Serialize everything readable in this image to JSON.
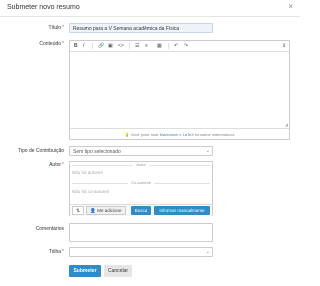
{
  "modal": {
    "title": "Submeter novo resumo",
    "close_glyph": "×"
  },
  "fields": {
    "title_label": "Título",
    "title_value": "Resumo para a V Semana acadêmica da Física",
    "content_label": "Conteúdo",
    "contribution_label": "Tipo de Contribuição",
    "contribution_value": "Sem tipo selecionado",
    "author_label": "Autor",
    "comments_label": "Comentários",
    "track_label": "Trilha",
    "required_mark": "*"
  },
  "editor": {
    "toolbar": {
      "bold": "B",
      "italic": "I",
      "link": "🔗",
      "comment": "▣",
      "code": "<>",
      "bullets": "☰",
      "numbered": "≡",
      "table": "▦",
      "undo": "↶",
      "redo": "↷",
      "info": "ℹ"
    },
    "hint_prefix": "Você pode usar",
    "hint_markdown": "Markdown",
    "hint_and": "e",
    "hint_latex": "LaTeX",
    "hint_suffix": "formatos matemáticos",
    "hint_icon": "💡"
  },
  "authors": {
    "author_section": "Autor",
    "author_empty": "Não há autores",
    "coauthor_section": "Co-autores",
    "coauthor_empty": "Não há co-autores",
    "sort_glyph": "⇅",
    "add_me_label": "Me adicione",
    "search_label": "Busca",
    "manual_label": "Informar manualmente",
    "user_icon": "👤"
  },
  "footer": {
    "submit_label": "Submeter",
    "cancel_label": "Cancelar"
  },
  "colors": {
    "primary": "#2e8cc9",
    "required": "#d9534f"
  }
}
